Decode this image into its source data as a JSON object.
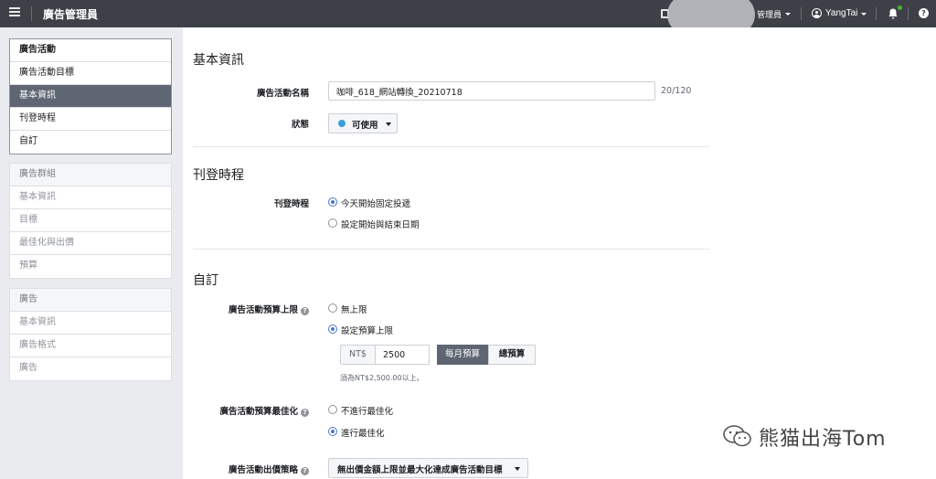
{
  "topbar": {
    "app_title": "廣告管理員",
    "role_label": "管理員",
    "user_name": "YangTai",
    "help_glyph": "?"
  },
  "sidebar": {
    "campaign": {
      "head": "廣告活動",
      "items": [
        "廣告活動目標",
        "基本資訊",
        "刊登時程",
        "自訂"
      ]
    },
    "adset": {
      "head": "廣告群組",
      "items": [
        "基本資訊",
        "目標",
        "最佳化與出價",
        "預算"
      ]
    },
    "ad": {
      "head": "廣告",
      "items": [
        "基本資訊",
        "廣告格式",
        "廣告"
      ]
    }
  },
  "basic_info": {
    "title": "基本資訊",
    "name_label": "廣告活動名稱",
    "name_value": "咖啡_618_網站轉換_20210718",
    "char_count": "20/120",
    "status_label": "狀態",
    "status_value": "可使用"
  },
  "schedule": {
    "title": "刊登時程",
    "label": "刊登時程",
    "option_today": "今天開始固定投遞",
    "option_range": "設定開始與結束日期"
  },
  "custom": {
    "title": "自訂",
    "budget_cap_label": "廣告活動預算上限",
    "no_cap": "無上限",
    "set_cap": "設定預算上限",
    "currency": "NT$",
    "amount": "2500",
    "monthly": "每月預算",
    "total": "總預算",
    "hint": "須為NT$2,500.00以上。",
    "optimization_label": "廣告活動預算最佳化",
    "opt_off": "不進行最佳化",
    "opt_on": "進行最佳化",
    "bid_strategy_label": "廣告活動出價策略",
    "bid_strategy_value": "無出價金額上限並最大化達成廣告活動目標"
  },
  "watermark": {
    "text": "熊猫出海Tom"
  },
  "colors": {
    "topbar": "#3d4047",
    "selected_nav": "#5f6673",
    "status_dot": "#3b9ed8",
    "radio_accent": "#4a76c9"
  }
}
